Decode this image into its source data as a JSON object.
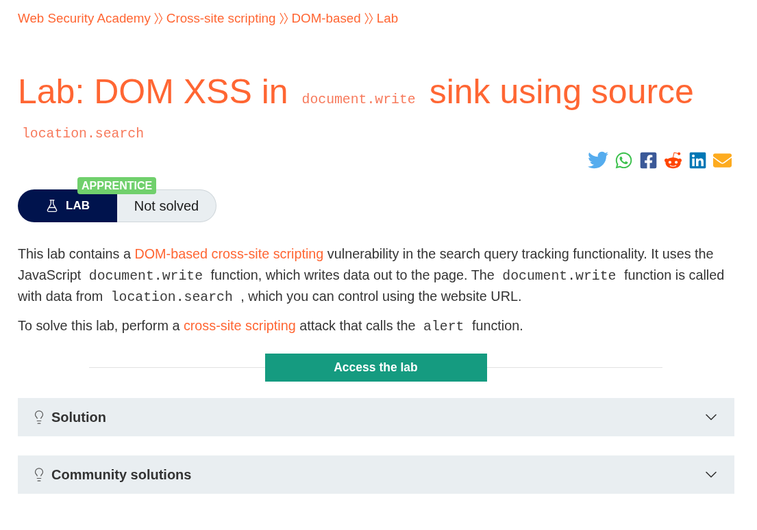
{
  "breadcrumb": [
    {
      "label": "Web Security Academy"
    },
    {
      "label": "Cross-site scripting"
    },
    {
      "label": "DOM-based"
    },
    {
      "label": "Lab"
    }
  ],
  "title": [
    {
      "kind": "text",
      "text": "Lab: DOM XSS in"
    },
    {
      "kind": "code",
      "text": "document.write"
    },
    {
      "kind": "text",
      "text": "sink using source"
    },
    {
      "kind": "code",
      "text": "location.search"
    }
  ],
  "lab": {
    "level": "APPRENTICE",
    "label": "LAB",
    "status": "Not solved"
  },
  "description": [
    {
      "segments": [
        {
          "kind": "text",
          "text": "This lab contains a"
        },
        {
          "kind": "link",
          "text": "DOM-based cross-site scripting"
        },
        {
          "kind": "text",
          "text": "vulnerability in the search query tracking functionality. It uses the JavaScript"
        },
        {
          "kind": "code",
          "text": "document.write"
        },
        {
          "kind": "text",
          "text": "function, which writes data out to the page. The"
        },
        {
          "kind": "code",
          "text": "document.write"
        },
        {
          "kind": "text",
          "text": "function is called with data from"
        },
        {
          "kind": "code",
          "text": "location.search"
        },
        {
          "kind": "text",
          "text": ", which you can control using the website URL."
        }
      ]
    },
    {
      "segments": [
        {
          "kind": "text",
          "text": "To solve this lab, perform a"
        },
        {
          "kind": "link",
          "text": "cross-site scripting"
        },
        {
          "kind": "text",
          "text": "attack that calls the"
        },
        {
          "kind": "code",
          "text": "alert"
        },
        {
          "kind": "text",
          "text": "function."
        }
      ]
    }
  ],
  "access_button": {
    "label": "Access the lab"
  },
  "accordions": [
    {
      "title": "Solution",
      "expanded": false
    },
    {
      "title": "Community solutions",
      "expanded": false
    }
  ]
}
